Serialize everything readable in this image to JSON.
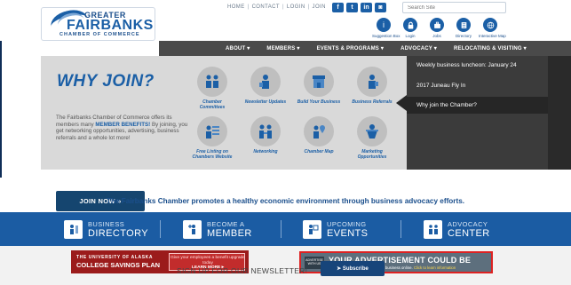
{
  "header": {
    "logo": {
      "greater": "GREATER",
      "name": "FAIRBANKS",
      "chamber": "CHAMBER OF COMMERCE"
    },
    "top_links": [
      "HOME",
      "CONTACT",
      "LOGIN",
      "JOIN"
    ],
    "social_icons": [
      "facebook-icon",
      "twitter-icon",
      "linkedin-icon",
      "instagram-icon"
    ],
    "social_glyphs": [
      "f",
      "t",
      "in",
      "◙"
    ],
    "search_placeholder": "Search Site",
    "quick_links": [
      {
        "label": "Suggestion Box",
        "icon": "info-icon",
        "glyph": "i"
      },
      {
        "label": "Login",
        "icon": "lock-icon",
        "glyph": "🔒"
      },
      {
        "label": "Jobs",
        "icon": "briefcase-icon",
        "glyph": "▣"
      },
      {
        "label": "Directory",
        "icon": "directory-icon",
        "glyph": "☰"
      },
      {
        "label": "Interactive Map",
        "icon": "map-icon",
        "glyph": "◎"
      }
    ]
  },
  "nav": {
    "items": [
      "ABOUT ▾",
      "MEMBERS ▾",
      "EVENTS & PROGRAMS ▾",
      "ADVOCACY ▾",
      "RELOCATING & VISITING ▾"
    ]
  },
  "hero": {
    "title": "WHY JOIN?",
    "intro_before": "The Fairbanks Chamber of Commerce offers its members many ",
    "intro_highlight": "MEMBER BENEFITS!",
    "intro_after": " By joining, you get networking opportunities, advertising, business referrals and a whole lot more!",
    "join_button": "JOIN NOW »",
    "benefits": [
      "Chamber Committees",
      "Newsletter Updates",
      "Build Your Business",
      "Business Referrals",
      "Free Listing on Chambers Website",
      "Networking",
      "Chamber Map",
      "Marketing Opportunities"
    ]
  },
  "side_panel": {
    "items": [
      "Weekly business luncheon: January 24",
      "2017 Juneau Fly In",
      "Why join the Chamber?"
    ],
    "active_index": 2
  },
  "tagline": "The Fairbanks Chamber promotes a healthy economic environment through business advocacy efforts.",
  "tiles": [
    {
      "line1": "BUSINESS",
      "line2": "DIRECTORY",
      "icon": "directory-icon"
    },
    {
      "line1": "BECOME A",
      "line2": "MEMBER",
      "icon": "add-member-icon"
    },
    {
      "line1": "UPCOMING",
      "line2": "EVENTS",
      "icon": "calendar-icon"
    },
    {
      "line1": "ADVOCACY",
      "line2": "CENTER",
      "icon": "advocacy-icon"
    }
  ],
  "ads": {
    "uaf": {
      "line1": "THE UNIVERSITY OF ALASKA",
      "line2": "COLLEGE SAVINGS PLAN",
      "box_text": "Give your employees a benefit upgrade today",
      "learn_more": "LEARN MORE ▸"
    },
    "advertise": {
      "tag": "ADVERTISE WITH US",
      "headline": "YOUR ADVERTISEMENT COULD BE HERE...",
      "sub": "Don't miss out on marketing your business online. ",
      "sub_link": "Click to learn information"
    }
  },
  "newsletter": {
    "label": "SIGN UP FOR OUR NEWSLETTER!",
    "button": "➤ Subscribe"
  },
  "colors": {
    "brand_blue": "#1b5ca3",
    "dark_nav": "#4a4a4a",
    "panel": "#3b3b3b",
    "ad_red": "#9b1b1b"
  }
}
